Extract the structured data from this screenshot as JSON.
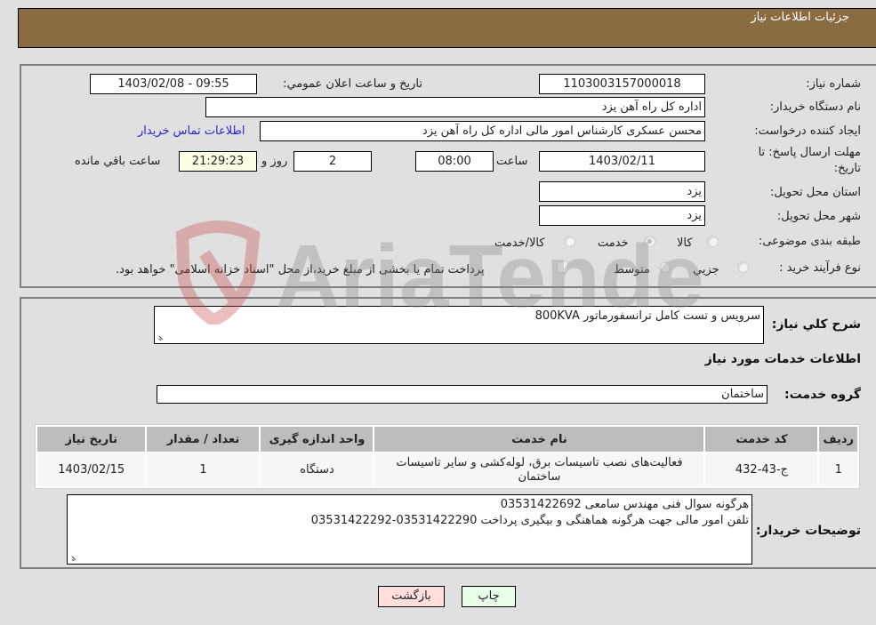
{
  "header": {
    "title": "جزئیات اطلاعات نیاز"
  },
  "form": {
    "need_number": {
      "label": "شماره نیاز:",
      "value": "1103003157000018"
    },
    "announce": {
      "label": "تاریخ و ساعت اعلان عمومي:",
      "value": "1403/02/08 - 09:55"
    },
    "buyer_org": {
      "label": "نام دستگاه خریدار:",
      "value": "اداره کل راه آهن یزد"
    },
    "requester": {
      "label": "ایجاد کننده درخواست:",
      "value": "محسن عسکری کارشناس امور مالی اداره کل راه آهن یزد"
    },
    "contact_link": "اطلاعات تماس خریدار",
    "deadline": {
      "label_line1": "مهلت ارسال پاسخ: تا",
      "label_line2": "تاریخ:",
      "date": "1403/02/11",
      "time_label": "ساعت",
      "time": "08:00",
      "days": "2",
      "days_label": "روز و",
      "remaining": "21:29:23",
      "remaining_label": "ساعت باقي مانده"
    },
    "province": {
      "label": "استان محل تحویل:",
      "value": "یزد"
    },
    "city": {
      "label": "شهر محل تحویل:",
      "value": "یزد"
    },
    "category": {
      "label": "طبقه بندی موضوعی:",
      "options": [
        "کالا",
        "خدمت",
        "کالا/خدمت"
      ],
      "selected": "خدمت"
    },
    "process": {
      "label": "نوع فرآیند خرید :",
      "options": [
        "جزیي",
        "متوسط"
      ],
      "treasury_note": "پرداخت تمام یا بخشی از مبلغ خرید،از محل \"اسناد خزانه اسلامی\" خواهد بود."
    }
  },
  "details": {
    "description_label": "شرح کلي نیاز:",
    "description": "سرویس و تست کامل ترانسفورماتور 800KVA",
    "services_heading": "اطلاعات خدمات مورد نیاز",
    "service_group_label": "گروه خدمت:",
    "service_group": "ساختمان",
    "table": {
      "headers": [
        "ردیف",
        "کد خدمت",
        "نام خدمت",
        "واحد اندازه گیری",
        "تعداد / مقدار",
        "تاریخ نیاز"
      ],
      "rows": [
        [
          "1",
          "ج-43-432",
          "فعالیت‌های نصب تاسیسات برق، لوله‌کشی و سایر تاسیسات ساختمان",
          "دستگاه",
          "1",
          "1403/02/15"
        ]
      ]
    },
    "buyer_notes_label": "توضیحات خریدار:",
    "buyer_notes_line1": "هرگونه سوال فنی مهندس سامعی 03531422692",
    "buyer_notes_line2": "تلفن امور مالی جهت هرگونه هماهنگی و بیگیری پرداخت 03531422290-03531422292"
  },
  "buttons": {
    "print": "چاپ",
    "back": "بازگشت"
  },
  "watermark": {
    "text": "AriaTender.neT"
  },
  "colors": {
    "header": "#8b6c42",
    "print_bg": "#eaffea",
    "back_bg": "#ffdede",
    "link": "#2424d6"
  }
}
